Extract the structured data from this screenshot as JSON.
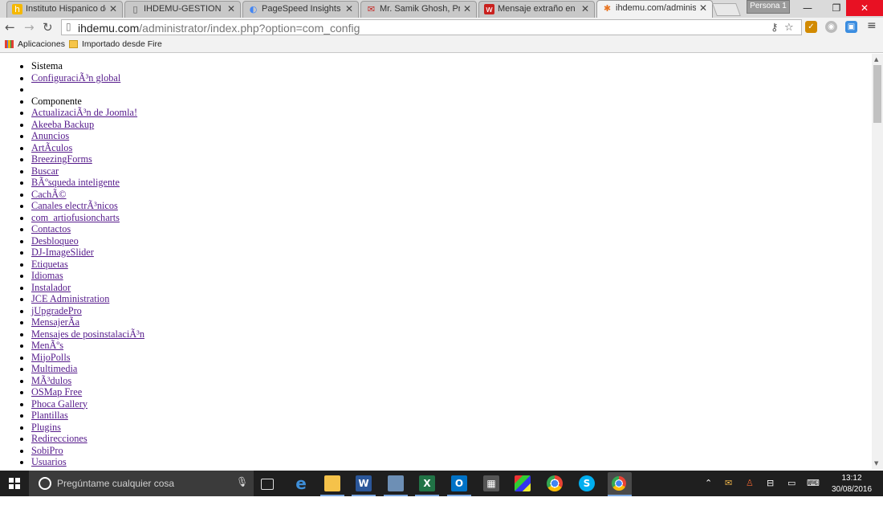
{
  "browser": {
    "tabs": [
      {
        "title": "Instituto Hispanico de M",
        "favicon": "h"
      },
      {
        "title": "IHDEMU-GESTION",
        "favicon": "doc"
      },
      {
        "title": "PageSpeed Insights",
        "favicon": "pagespeed"
      },
      {
        "title": "Mr. Samik Ghosh, Princi",
        "favicon": "mail"
      },
      {
        "title": "Mensaje extraño en cab",
        "favicon": "w"
      },
      {
        "title": "ihdemu.com/administra",
        "favicon": "joomla"
      }
    ],
    "profile_label": "Persona 1",
    "url": {
      "host": "ihdemu.com",
      "path": "/administrator/index.php?option=com_config"
    },
    "bookmarks": [
      {
        "label": "Aplicaciones"
      },
      {
        "label": "Importado desde Fire"
      }
    ]
  },
  "page": {
    "items": [
      {
        "label": "Sistema",
        "link": false
      },
      {
        "label": "ConfiguraciÃ³n global",
        "link": true
      },
      {
        "label": "",
        "link": false
      },
      {
        "label": "Componente",
        "link": false
      },
      {
        "label": "ActualizaciÃ³n de Joomla!",
        "link": true
      },
      {
        "label": "Akeeba Backup",
        "link": true
      },
      {
        "label": "Anuncios",
        "link": true
      },
      {
        "label": "ArtÃ­culos",
        "link": true
      },
      {
        "label": "BreezingForms",
        "link": true
      },
      {
        "label": "Buscar",
        "link": true
      },
      {
        "label": "BÃºsqueda inteligente",
        "link": true
      },
      {
        "label": "CachÃ©",
        "link": true
      },
      {
        "label": "Canales electrÃ³nicos",
        "link": true
      },
      {
        "label": "com_artiofusioncharts",
        "link": true
      },
      {
        "label": "Contactos",
        "link": true
      },
      {
        "label": "Desbloqueo",
        "link": true
      },
      {
        "label": "DJ-ImageSlider",
        "link": true
      },
      {
        "label": "Etiquetas",
        "link": true
      },
      {
        "label": "Idiomas",
        "link": true
      },
      {
        "label": "Instalador",
        "link": true
      },
      {
        "label": "JCE Administration",
        "link": true
      },
      {
        "label": "jUpgradePro",
        "link": true
      },
      {
        "label": "MensajerÃ­a",
        "link": true
      },
      {
        "label": "Mensajes de posinstalaciÃ³n",
        "link": true
      },
      {
        "label": "MenÃºs",
        "link": true
      },
      {
        "label": "MijoPolls",
        "link": true
      },
      {
        "label": "Multimedia",
        "link": true
      },
      {
        "label": "MÃ³dulos",
        "link": true
      },
      {
        "label": "OSMap Free",
        "link": true
      },
      {
        "label": "Phoca Gallery",
        "link": true
      },
      {
        "label": "Plantillas",
        "link": true
      },
      {
        "label": "Plugins",
        "link": true
      },
      {
        "label": "Redirecciones",
        "link": true
      },
      {
        "label": "SobiPro",
        "link": true
      },
      {
        "label": "Usuarios",
        "link": true
      }
    ]
  },
  "taskbar": {
    "search_placeholder": "Pregúntame cualquier cosa",
    "time": "13:12",
    "date": "30/08/2016"
  },
  "colors": {
    "link": "#551a8b",
    "taskbar": "#1f1f1f",
    "close_button": "#e81123"
  }
}
